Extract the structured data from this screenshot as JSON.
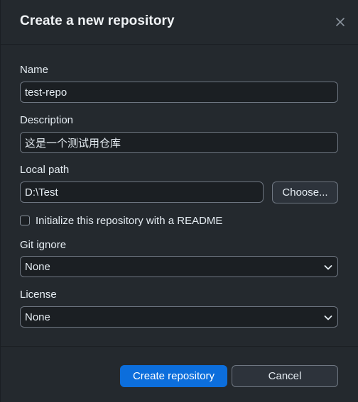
{
  "dialog": {
    "title": "Create a new repository"
  },
  "form": {
    "name_label": "Name",
    "name_value": "test-repo",
    "description_label": "Description",
    "description_value": "这是一个测试用仓库",
    "local_path_label": "Local path",
    "local_path_value": "D:\\Test",
    "choose_label": "Choose...",
    "readme_label": "Initialize this repository with a README",
    "readme_checked": false,
    "gitignore_label": "Git ignore",
    "gitignore_value": "None",
    "license_label": "License",
    "license_value": "None"
  },
  "footer": {
    "create_label": "Create repository",
    "cancel_label": "Cancel"
  },
  "icons": {
    "close": "close-icon",
    "chevron": "chevron-down-icon"
  },
  "colors": {
    "primary": "#0c6edc",
    "background": "#24292e",
    "input_background": "#1b1f23"
  }
}
